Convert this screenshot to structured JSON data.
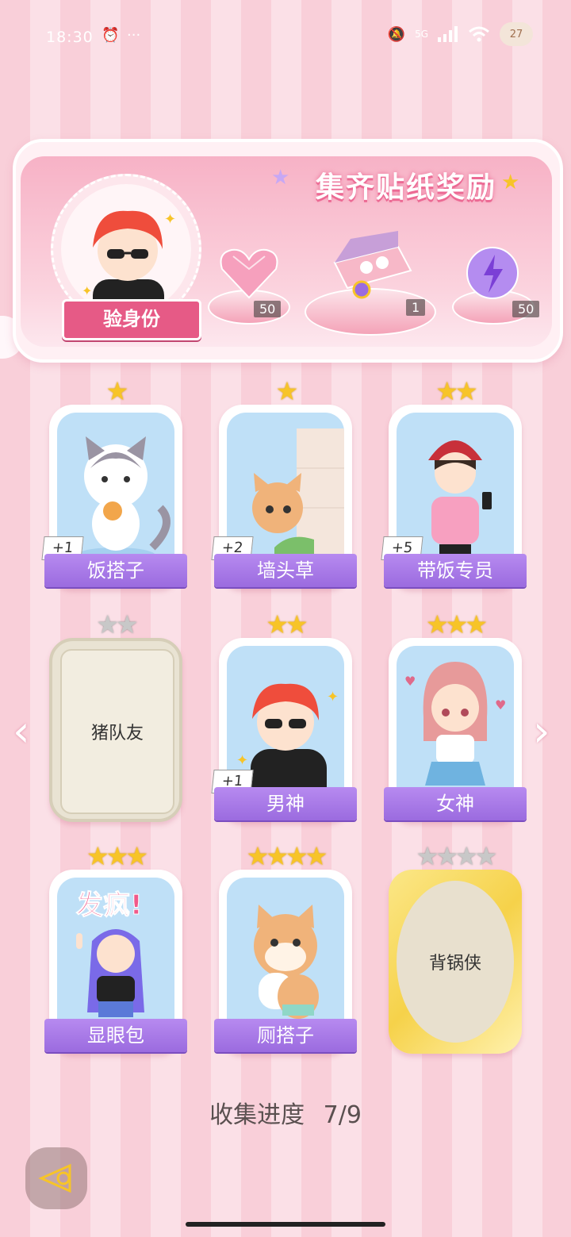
{
  "status_bar": {
    "time": "18:30",
    "more": "···",
    "network": "5G",
    "battery": "27"
  },
  "banner": {
    "title": "集齐贴纸奖励",
    "verify_label": "验身份"
  },
  "rewards": [
    {
      "name": "heart-gem",
      "count": "50"
    },
    {
      "name": "gift-box",
      "count": "1"
    },
    {
      "name": "energy-orb",
      "count": "50"
    }
  ],
  "cards": [
    {
      "name": "饭搭子",
      "stars": 1,
      "plus": "+1",
      "state": "unlocked",
      "bg": "#bfe0f7"
    },
    {
      "name": "墙头草",
      "stars": 1,
      "plus": "+2",
      "state": "unlocked",
      "bg": "#bfe0f7"
    },
    {
      "name": "带饭专员",
      "stars": 2,
      "plus": "+5",
      "state": "unlocked",
      "bg": "#bfe0f7"
    },
    {
      "name": "猪队友",
      "stars": 2,
      "plus": "",
      "state": "locked",
      "bg": ""
    },
    {
      "name": "男神",
      "stars": 2,
      "plus": "+1",
      "state": "unlocked",
      "bg": "#bfe0f7"
    },
    {
      "name": "女神",
      "stars": 3,
      "plus": "",
      "state": "unlocked",
      "bg": "#bfe0f7"
    },
    {
      "name": "显眼包",
      "stars": 3,
      "plus": "",
      "state": "unlocked",
      "bg": "#bfe0f7"
    },
    {
      "name": "厕搭子",
      "stars": 4,
      "plus": "",
      "state": "unlocked",
      "bg": "#bfe0f7"
    },
    {
      "name": "背锅侠",
      "stars": 4,
      "plus": "",
      "state": "gold-locked",
      "bg": ""
    }
  ],
  "card_art_text": {
    "fafeng": "发疯!"
  },
  "progress": {
    "label": "收集进度",
    "value": "7/9"
  },
  "colors": {
    "accent": "#e65a86",
    "label_purple": "#9b6bdf",
    "star_gold": "#f7c428"
  }
}
